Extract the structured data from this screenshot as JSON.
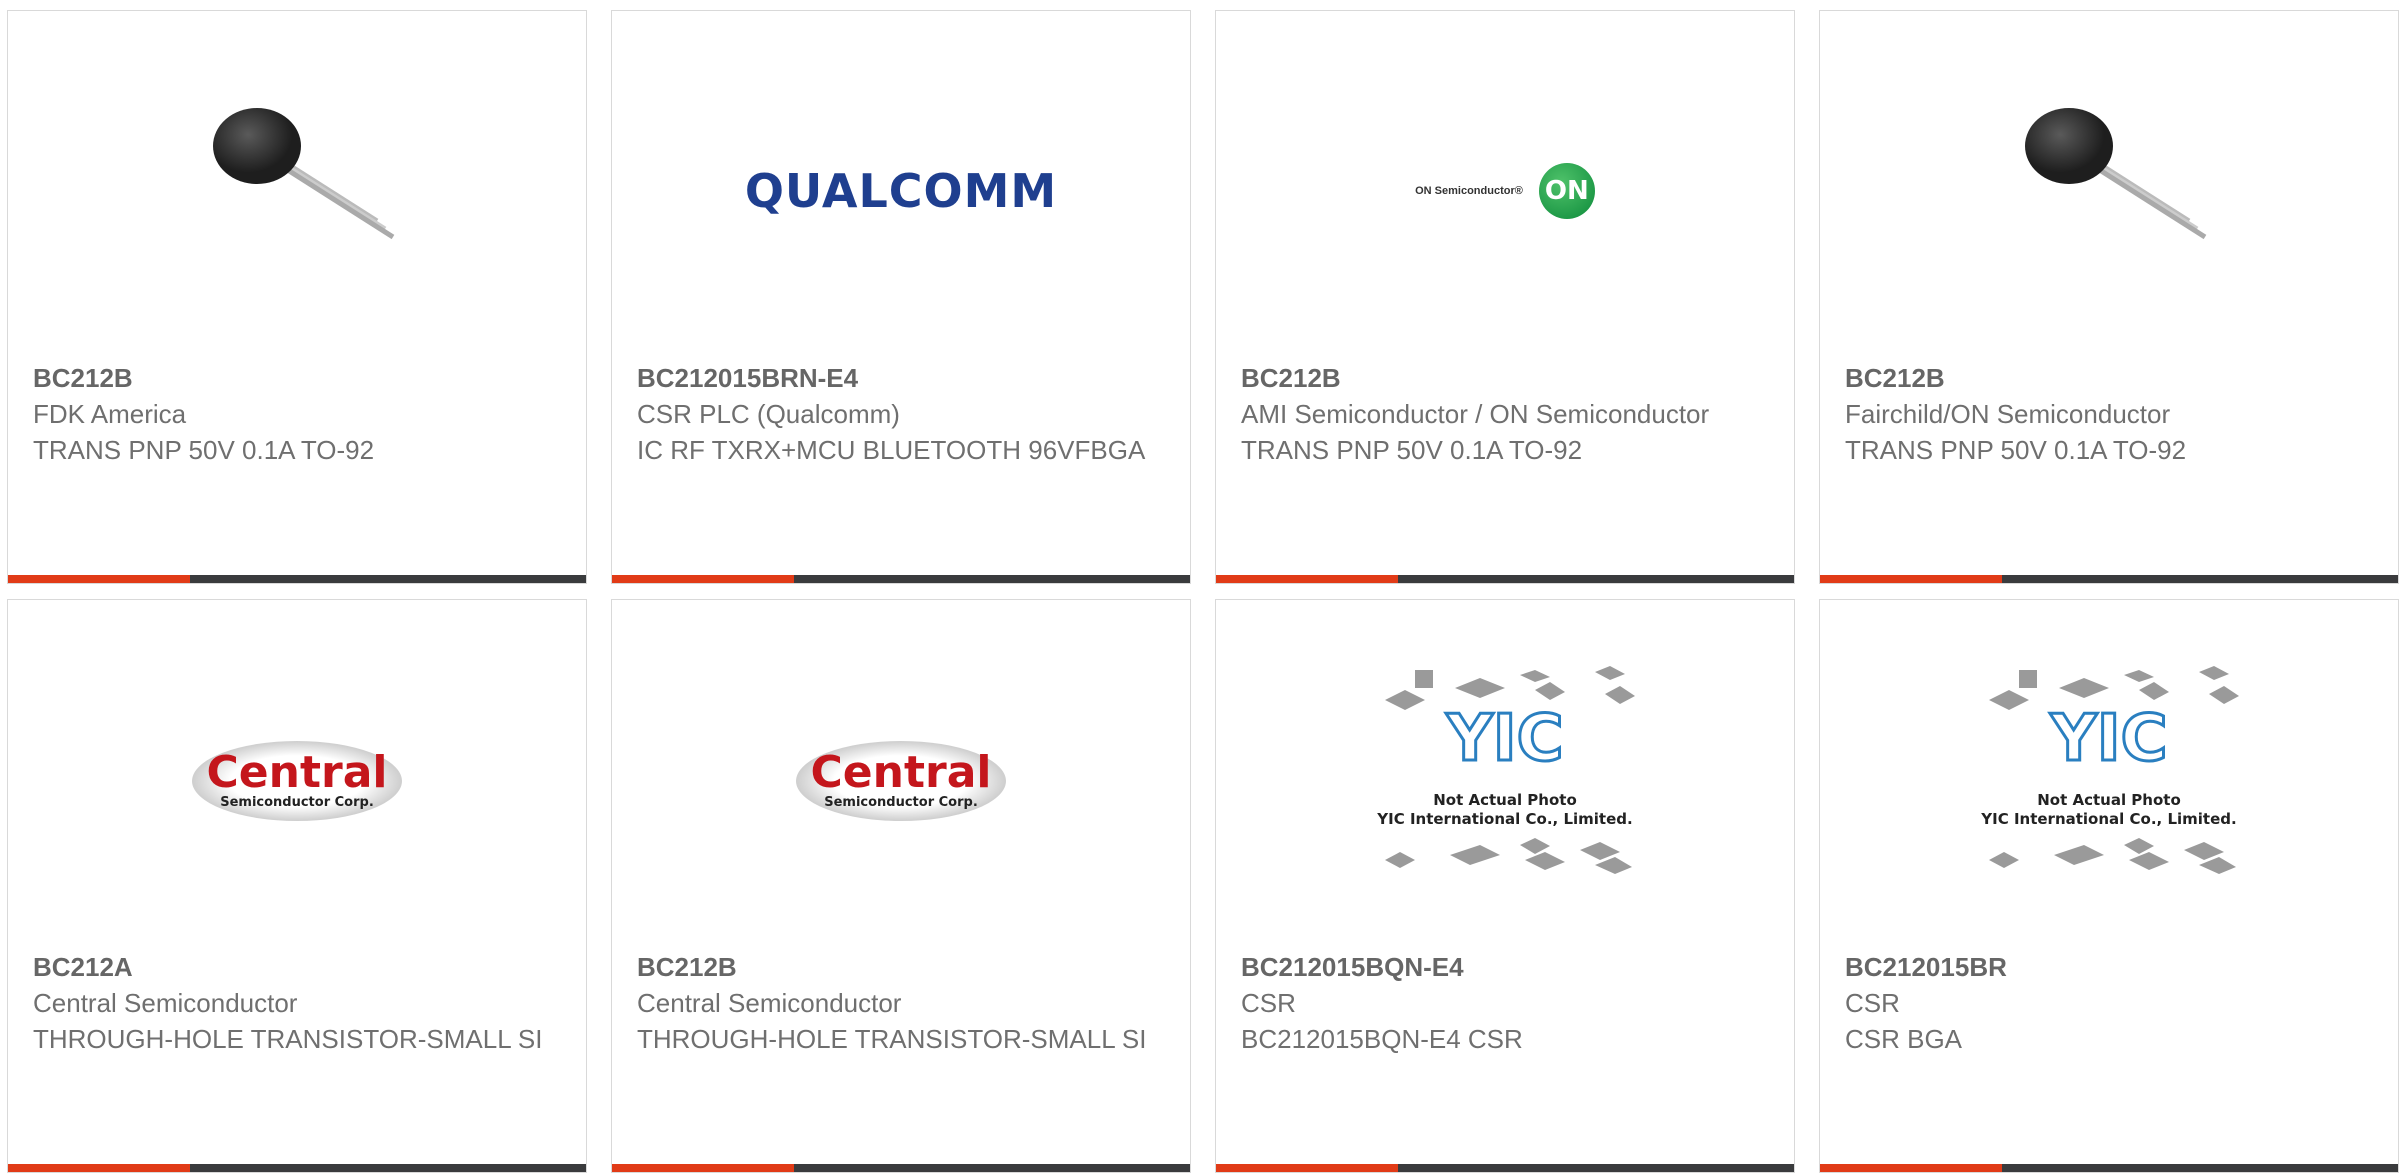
{
  "cards": [
    {
      "part": "BC212B",
      "manufacturer": "FDK America",
      "description": "TRANS PNP 50V 0.1A TO-92",
      "image": "to92-transistor"
    },
    {
      "part": "BC212015BRN-E4",
      "manufacturer": "CSR PLC (Qualcomm)",
      "description": "IC RF TXRX+MCU BLUETOOTH 96VFBGA",
      "image": "qualcomm-logo",
      "logo_text": "QUALCOMM"
    },
    {
      "part": "BC212B",
      "manufacturer": "AMI Semiconductor / ON Semiconductor",
      "description": "TRANS PNP 50V 0.1A TO-92",
      "image": "on-semiconductor-logo",
      "logo_text": "ON Semiconductor®",
      "logo_badge": "ON"
    },
    {
      "part": "BC212B",
      "manufacturer": "Fairchild/ON Semiconductor",
      "description": "TRANS PNP 50V 0.1A TO-92",
      "image": "to92-transistor"
    },
    {
      "part": "BC212A",
      "manufacturer": "Central Semiconductor",
      "description": "THROUGH-HOLE TRANSISTOR-SMALL SI",
      "image": "central-semiconductor-logo",
      "logo_text": "Central",
      "logo_sub": "Semiconductor Corp."
    },
    {
      "part": "BC212B",
      "manufacturer": "Central Semiconductor",
      "description": "THROUGH-HOLE TRANSISTOR-SMALL SI",
      "image": "central-semiconductor-logo",
      "logo_text": "Central",
      "logo_sub": "Semiconductor Corp."
    },
    {
      "part": "BC212015BQN-E4",
      "manufacturer": "CSR",
      "description": "BC212015BQN-E4 CSR",
      "image": "yic-placeholder",
      "logo_line1": "Not Actual Photo",
      "logo_line2": "YIC International Co., Limited."
    },
    {
      "part": "BC212015BR",
      "manufacturer": "CSR",
      "description": "CSR BGA",
      "image": "yic-placeholder",
      "logo_line1": "Not Actual Photo",
      "logo_line2": "YIC International Co., Limited."
    }
  ],
  "colors": {
    "accent": "#e13b17",
    "bar": "#3a3b3d",
    "text": "#6f6f6f"
  }
}
